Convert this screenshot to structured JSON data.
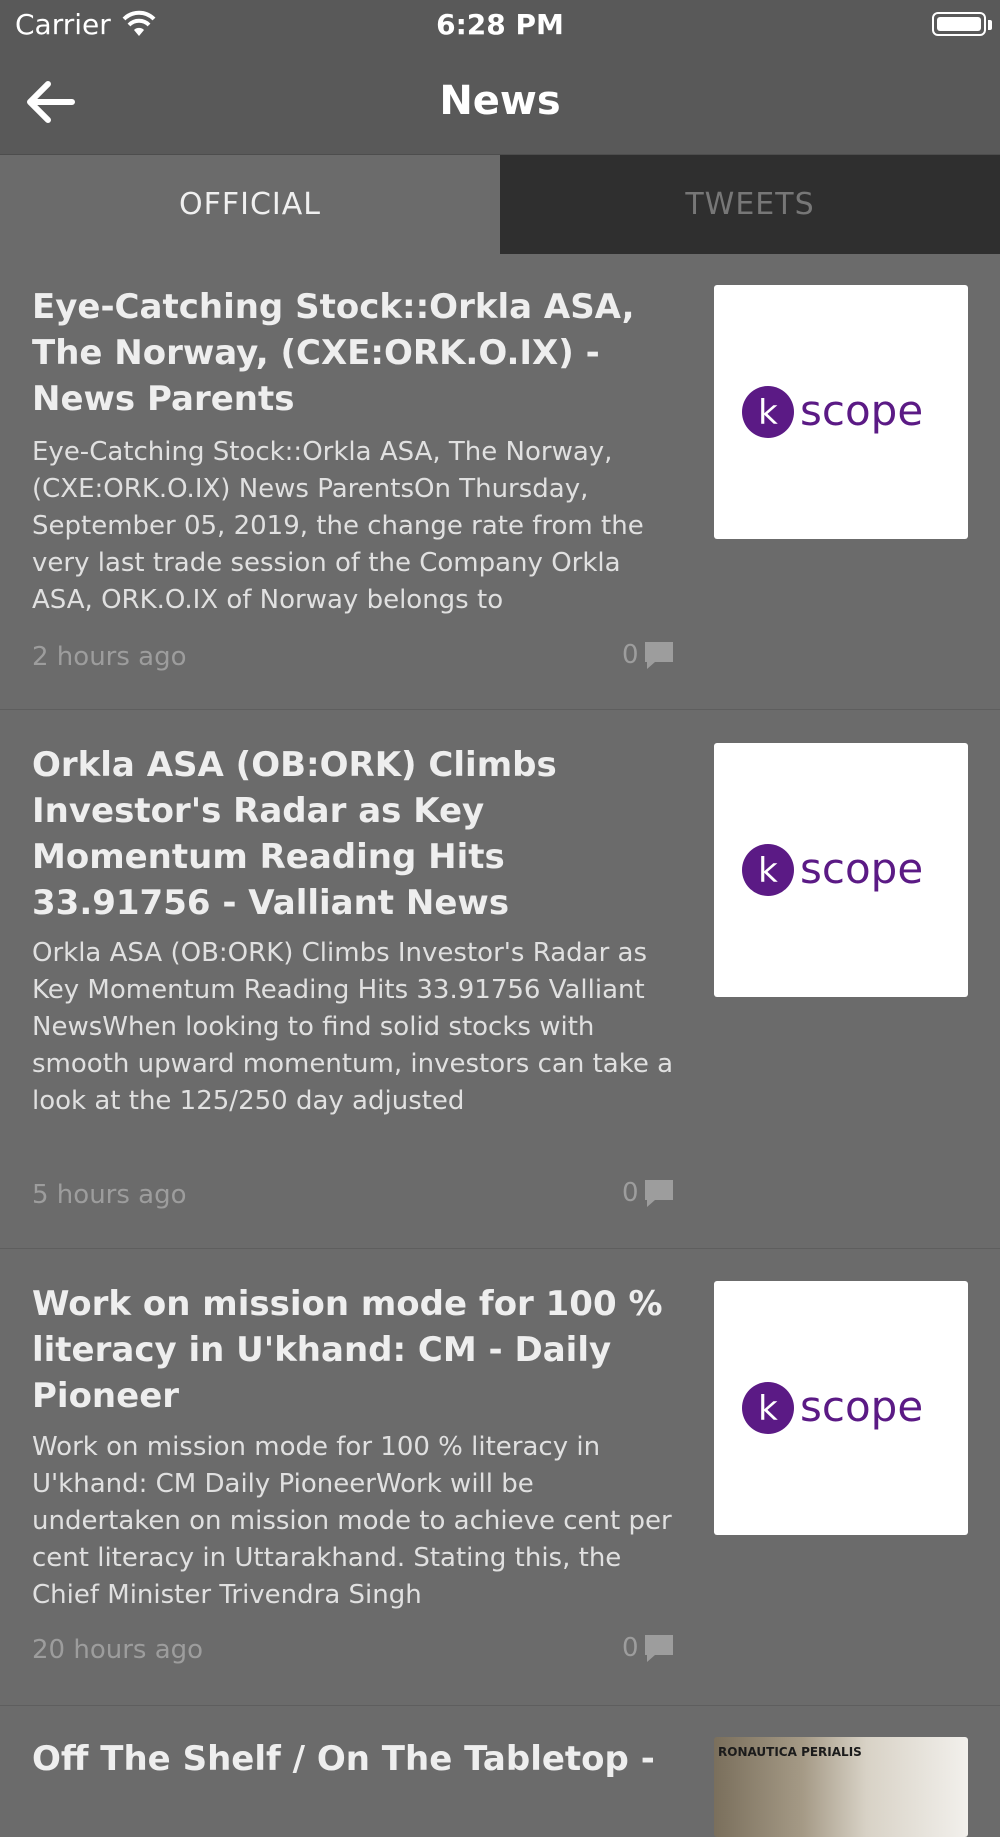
{
  "status_bar": {
    "carrier": "Carrier",
    "time": "6:28 PM"
  },
  "nav": {
    "title": "News",
    "back_icon": "arrow-left-icon"
  },
  "tabs": [
    {
      "label": "OFFICIAL",
      "selected": true
    },
    {
      "label": "TWEETS",
      "selected": false
    }
  ],
  "articles": [
    {
      "headline": "Eye-Catching Stock::Orkla ASA, The Norway, (CXE:ORK.O.IX) - News Parents",
      "summary": "Eye-Catching Stock::Orkla ASA, The Norway, (CXE:ORK.O.IX)  News ParentsOn Thursday, September 05, 2019, the change rate from the very last trade session of the Company Orkla ASA, ORK.O.IX of Norway belongs to",
      "time": "2 hours ago",
      "comments": "0",
      "thumb_logo": {
        "letter": "k",
        "text": "scope"
      }
    },
    {
      "headline": "Orkla ASA (OB:ORK) Climbs Investor's Radar as Key Momentum Reading Hits 33.91756 - Valliant News",
      "summary": "Orkla ASA (OB:ORK) Climbs Investor's Radar as Key Momentum Reading Hits 33.91756  Valliant NewsWhen looking to find solid stocks with smooth upward momentum, investors can take a look at the 125/250 day adjusted",
      "time": "5 hours ago",
      "comments": "0",
      "thumb_logo": {
        "letter": "k",
        "text": "scope"
      }
    },
    {
      "headline": "Work on mission mode for 100 % literacy in U'khand: CM - Daily Pioneer",
      "summary": "Work on mission mode for 100 % literacy in U'khand: CM  Daily PioneerWork will be undertaken on mission mode to achieve cent per cent literacy in Uttarakhand. Stating this, the Chief Minister Trivendra Singh",
      "time": "20 hours ago",
      "comments": "0",
      "thumb_logo": {
        "letter": "k",
        "text": "scope"
      }
    },
    {
      "headline": "Off The Shelf / On The Tabletop -",
      "thumb_photo_text": "RONAUTICA PERIALIS"
    }
  ],
  "colors": {
    "logo_purple": "#5b1a85",
    "tab_selected_bg": "#6b6b6b",
    "tab_unselected_bg": "#2f2f2f"
  }
}
